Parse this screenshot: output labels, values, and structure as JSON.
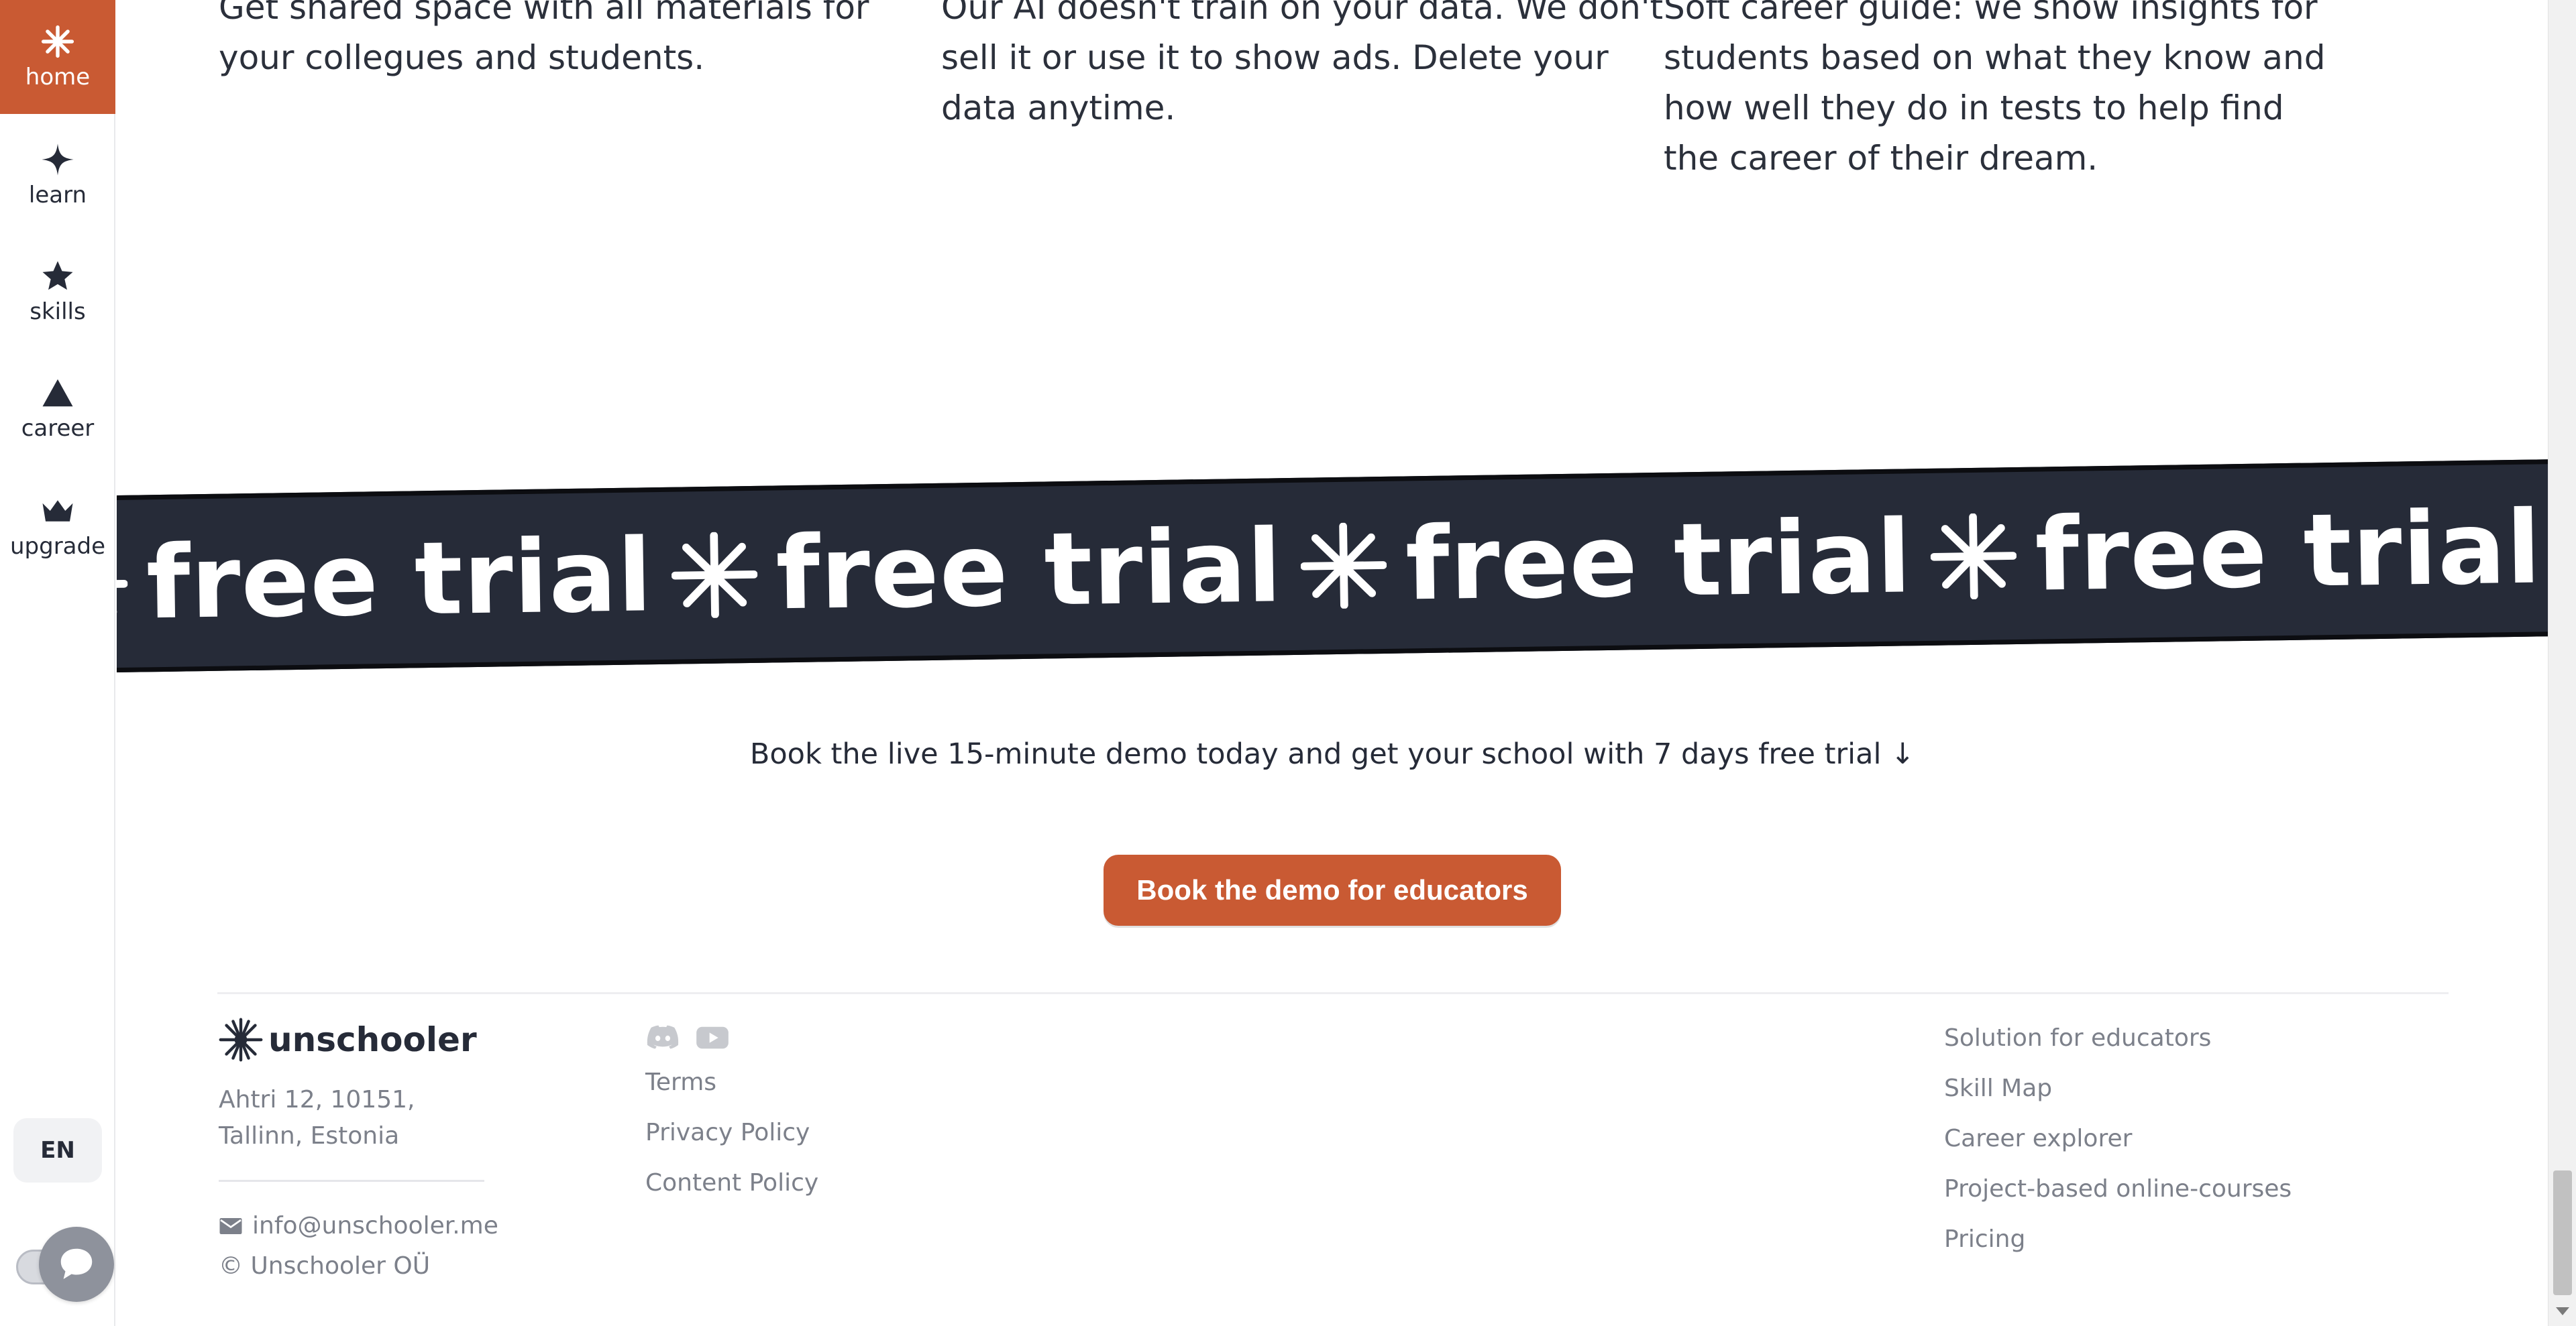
{
  "sidebar": {
    "items": [
      {
        "label": "home",
        "icon": "sparkle-icon",
        "active": true
      },
      {
        "label": "learn",
        "icon": "four-point-star-icon",
        "active": false
      },
      {
        "label": "skills",
        "icon": "star-icon",
        "active": false
      },
      {
        "label": "career",
        "icon": "triangle-icon",
        "active": false
      },
      {
        "label": "upgrade",
        "icon": "crown-icon",
        "active": false
      }
    ],
    "language": "EN"
  },
  "features": [
    {
      "text": "Get shared space with all materials for your collegues and students."
    },
    {
      "text": "Our AI doesn't train on your data. We don't sell it or use it to show ads. Delete your data anytime."
    },
    {
      "text": "Soft career guide: we show insights for students based on what they know and how well they do in tests to help find the career of their dream."
    }
  ],
  "ribbon": {
    "text": "free trial"
  },
  "cta": {
    "text": "Book the live 15-minute demo today and get your school with 7 days free trial ↓",
    "button_label": "Book the demo for educators"
  },
  "footer": {
    "brand": "unschooler",
    "address_line1": "Ahtri 12, 10151,",
    "address_line2": "Tallinn, Estonia",
    "email": "info@unschooler.me",
    "copyright": "© Unschooler OÜ",
    "social_icons": [
      "discord-icon",
      "youtube-icon"
    ],
    "links_left": [
      "Terms",
      "Privacy Policy",
      "Content Policy"
    ],
    "links_right": [
      "Solution for educators",
      "Skill Map",
      "Career explorer",
      "Project-based online-courses",
      "Pricing"
    ]
  },
  "colors": {
    "accent": "#c95a33",
    "dark": "#262b38",
    "muted_text": "#7c808a"
  }
}
